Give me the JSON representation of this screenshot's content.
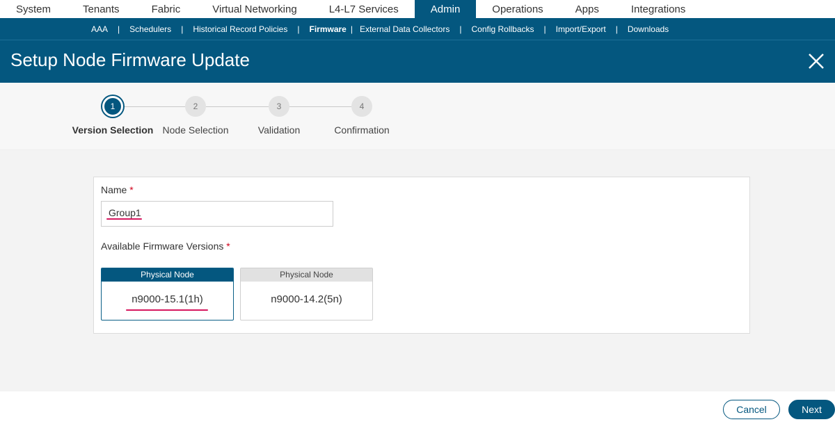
{
  "topnav": {
    "tabs": [
      {
        "label": "System"
      },
      {
        "label": "Tenants"
      },
      {
        "label": "Fabric"
      },
      {
        "label": "Virtual Networking"
      },
      {
        "label": "L4-L7 Services"
      },
      {
        "label": "Admin"
      },
      {
        "label": "Operations"
      },
      {
        "label": "Apps"
      },
      {
        "label": "Integrations"
      }
    ],
    "active": "Admin"
  },
  "subnav": {
    "items": [
      {
        "label": "AAA"
      },
      {
        "label": "Schedulers"
      },
      {
        "label": "Historical Record Policies"
      },
      {
        "label": "Firmware"
      },
      {
        "label": "External Data Collectors"
      },
      {
        "label": "Config Rollbacks"
      },
      {
        "label": "Import/Export"
      },
      {
        "label": "Downloads"
      }
    ],
    "active": "Firmware",
    "separator": "|"
  },
  "header": {
    "title": "Setup Node Firmware Update",
    "close_icon": "close-icon"
  },
  "stepper": {
    "steps": [
      {
        "number": "1",
        "label": "Version Selection",
        "active": true
      },
      {
        "number": "2",
        "label": "Node Selection",
        "active": false
      },
      {
        "number": "3",
        "label": "Validation",
        "active": false
      },
      {
        "number": "4",
        "label": "Confirmation",
        "active": false
      }
    ]
  },
  "form": {
    "name_label": "Name",
    "name_value": "Group1",
    "required_mark": "*",
    "versions_label": "Available Firmware Versions",
    "versions": [
      {
        "header": "Physical Node",
        "version": "n9000-15.1(1h)",
        "selected": true
      },
      {
        "header": "Physical Node",
        "version": "n9000-14.2(5n)",
        "selected": false
      }
    ]
  },
  "footer": {
    "cancel_label": "Cancel",
    "next_label": "Next"
  },
  "colors": {
    "primary": "#04577f",
    "required": "#d0021b",
    "annotation_underline": "#d6175e"
  }
}
